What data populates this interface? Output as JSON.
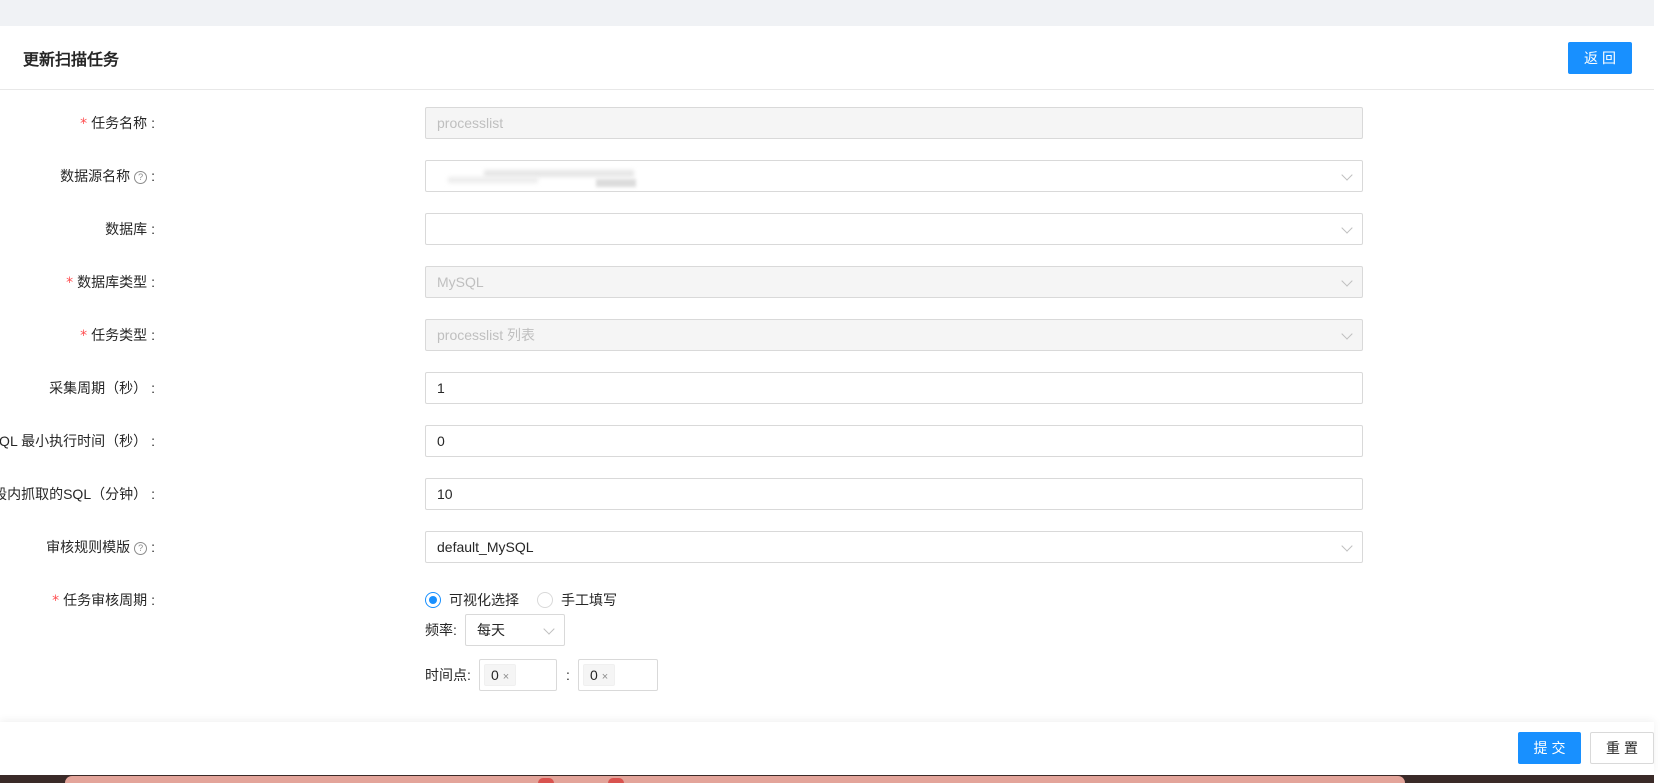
{
  "header": {
    "title": "更新扫描任务",
    "back_label": "返回"
  },
  "form": {
    "task_name": {
      "label": "任务名称",
      "value": "processlist",
      "required": true
    },
    "datasource": {
      "label": "数据源名称",
      "value": ""
    },
    "database": {
      "label": "数据库",
      "value": ""
    },
    "db_type": {
      "label": "数据库类型",
      "value": "MySQL",
      "required": true
    },
    "task_type": {
      "label": "任务类型",
      "value": "processlist 列表",
      "required": true
    },
    "collect_period": {
      "label": "采集周期（秒）",
      "value": "1"
    },
    "sql_min_exec": {
      "label": "SQL 最小执行时间（秒）",
      "value": "0"
    },
    "audit_window": {
      "label": "审核过去时间段内抓取的SQL（分钟）",
      "value": "10"
    },
    "rule_template": {
      "label": "审核规则模版",
      "value": "default_MySQL"
    },
    "audit_cycle": {
      "label": "任务审核周期",
      "required": true,
      "options": [
        "可视化选择",
        "手工填写"
      ],
      "selected": "可视化选择",
      "frequency_label": "频率:",
      "frequency_value": "每天",
      "time_label": "时间点:",
      "hour_value": "0",
      "minute_value": "0",
      "separator": ":",
      "remove_glyph": "×"
    }
  },
  "footer": {
    "submit_label": "提交",
    "reset_label": "重置"
  },
  "colors": {
    "primary": "#1890ff",
    "required": "#ff4d4f",
    "border": "#d9d9d9",
    "disabled_bg": "#f5f5f5"
  }
}
